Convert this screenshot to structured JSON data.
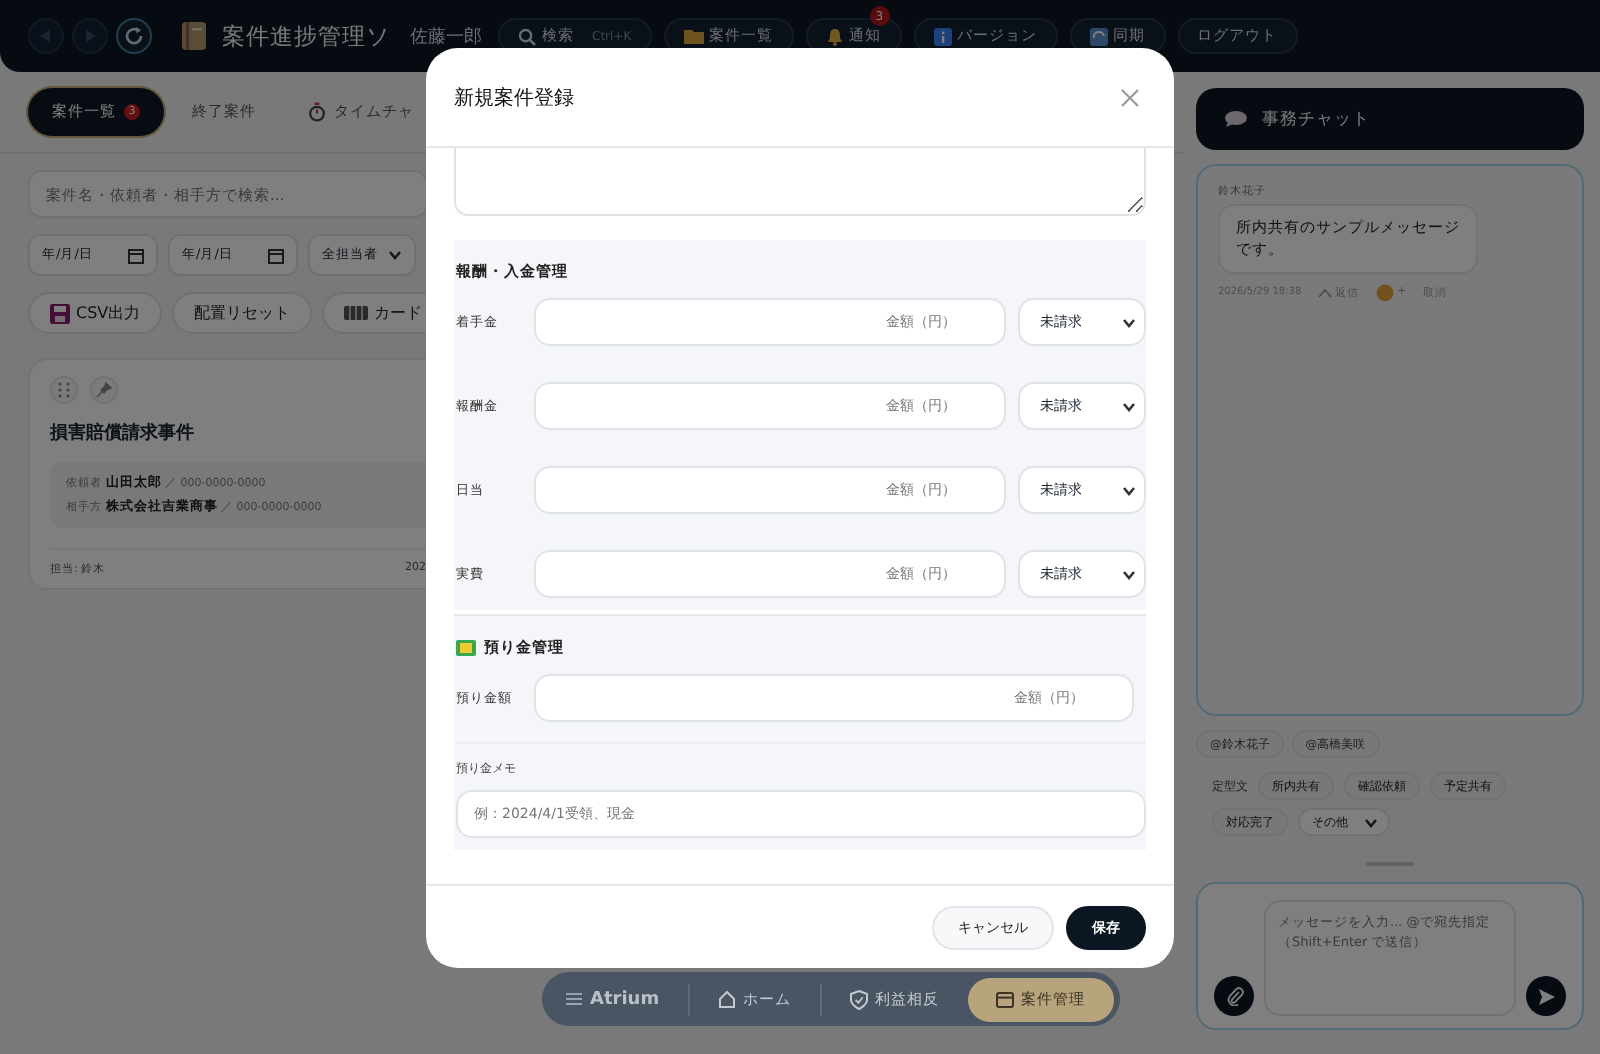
{
  "topbar": {
    "nav_buttons": [
      {
        "kind": "back",
        "disabled": true
      },
      {
        "kind": "forward",
        "disabled": true
      },
      {
        "kind": "reload",
        "disabled": false
      }
    ],
    "app_title": "案件進捗管理ソ",
    "user": "佐藤一郎",
    "buttons": [
      {
        "kind": "search",
        "label": "検索",
        "shortcut": "Ctrl+K"
      },
      {
        "kind": "folder",
        "label": "案件一覧"
      },
      {
        "kind": "bell",
        "label": "通知",
        "badge": "3"
      },
      {
        "kind": "info",
        "label": "バージョン"
      },
      {
        "kind": "sync",
        "label": "同期"
      },
      {
        "kind": "plain",
        "label": "ログアウト"
      }
    ]
  },
  "tabs": [
    {
      "kind": "plain",
      "label": "案件一覧",
      "selected": true,
      "badge": "3"
    },
    {
      "kind": "plain",
      "label": "終了案件",
      "selected": false
    },
    {
      "kind": "timer",
      "label": "タイムチャ",
      "selected": false
    }
  ],
  "search": {
    "placeholder": "案件名・依頼者・相手方で検索..."
  },
  "filters": [
    {
      "kind": "date",
      "value": "年/月/日"
    },
    {
      "kind": "date",
      "value": "年/月/日"
    },
    {
      "kind": "select",
      "value": "全担当者"
    }
  ],
  "actions": [
    {
      "kind": "save",
      "label": "CSV出力"
    },
    {
      "kind": "plain",
      "label": "配置リセット"
    },
    {
      "kind": "cards",
      "label": "カード"
    }
  ],
  "case_card": {
    "title": "損害賠償請求事件",
    "parties": [
      "依頼者 **山田太郎** ／ 000-0000-0000",
      "相手方 **株式会社吉業商事** ／ 000-0000-0000"
    ],
    "assignee": "担当: 鈴木",
    "date": "202"
  },
  "chat": {
    "title": "事務チャット",
    "messages": [
      {
        "sender": "鈴木花子",
        "text": "所内共有のサンプルメッセージです。",
        "time": "2026/5/29 18:38",
        "reply": "返信",
        "reaction": "+",
        "delete": "取消"
      }
    ],
    "mentions": [
      "@鈴木花子",
      "@高橋美咲"
    ],
    "templates_label": "定型文",
    "templates": [
      "所内共有",
      "確認依頼",
      "予定共有",
      "対応完了"
    ],
    "template_select": "その他",
    "input": {
      "placeholder": "メッセージを入力... @で宛先指定（Shift+Enter で送信）"
    }
  },
  "dialog": {
    "title": "新規案件登録",
    "fees": {
      "title": "報酬・入金管理",
      "rows": [
        {
          "label": "着手金",
          "placeholder": "金額（円）",
          "status": "未請求"
        },
        {
          "label": "報酬金",
          "placeholder": "金額（円）",
          "status": "未請求"
        },
        {
          "label": "日当",
          "placeholder": "金額（円）",
          "status": "未請求"
        },
        {
          "label": "実費",
          "placeholder": "金額（円）",
          "status": "未請求"
        }
      ]
    },
    "deposit": {
      "title": "預り金管理",
      "amount_label": "預り金額",
      "amount_placeholder": "金額（円）",
      "memo_label": "預り金メモ",
      "memo_placeholder": "例：2024/4/1受領、現金"
    },
    "buttons": [
      {
        "kind": "secondary",
        "label": "キャンセル"
      },
      {
        "kind": "primary",
        "label": "保存"
      }
    ]
  },
  "bottom_nav": [
    {
      "kind": "menu",
      "label": "Atrium",
      "selected": false
    },
    {
      "kind": "home",
      "label": "ホーム",
      "selected": false
    },
    {
      "kind": "shield",
      "label": "利益相反",
      "selected": false
    },
    {
      "kind": "calendar",
      "label": "案件管理",
      "selected": true
    }
  ]
}
